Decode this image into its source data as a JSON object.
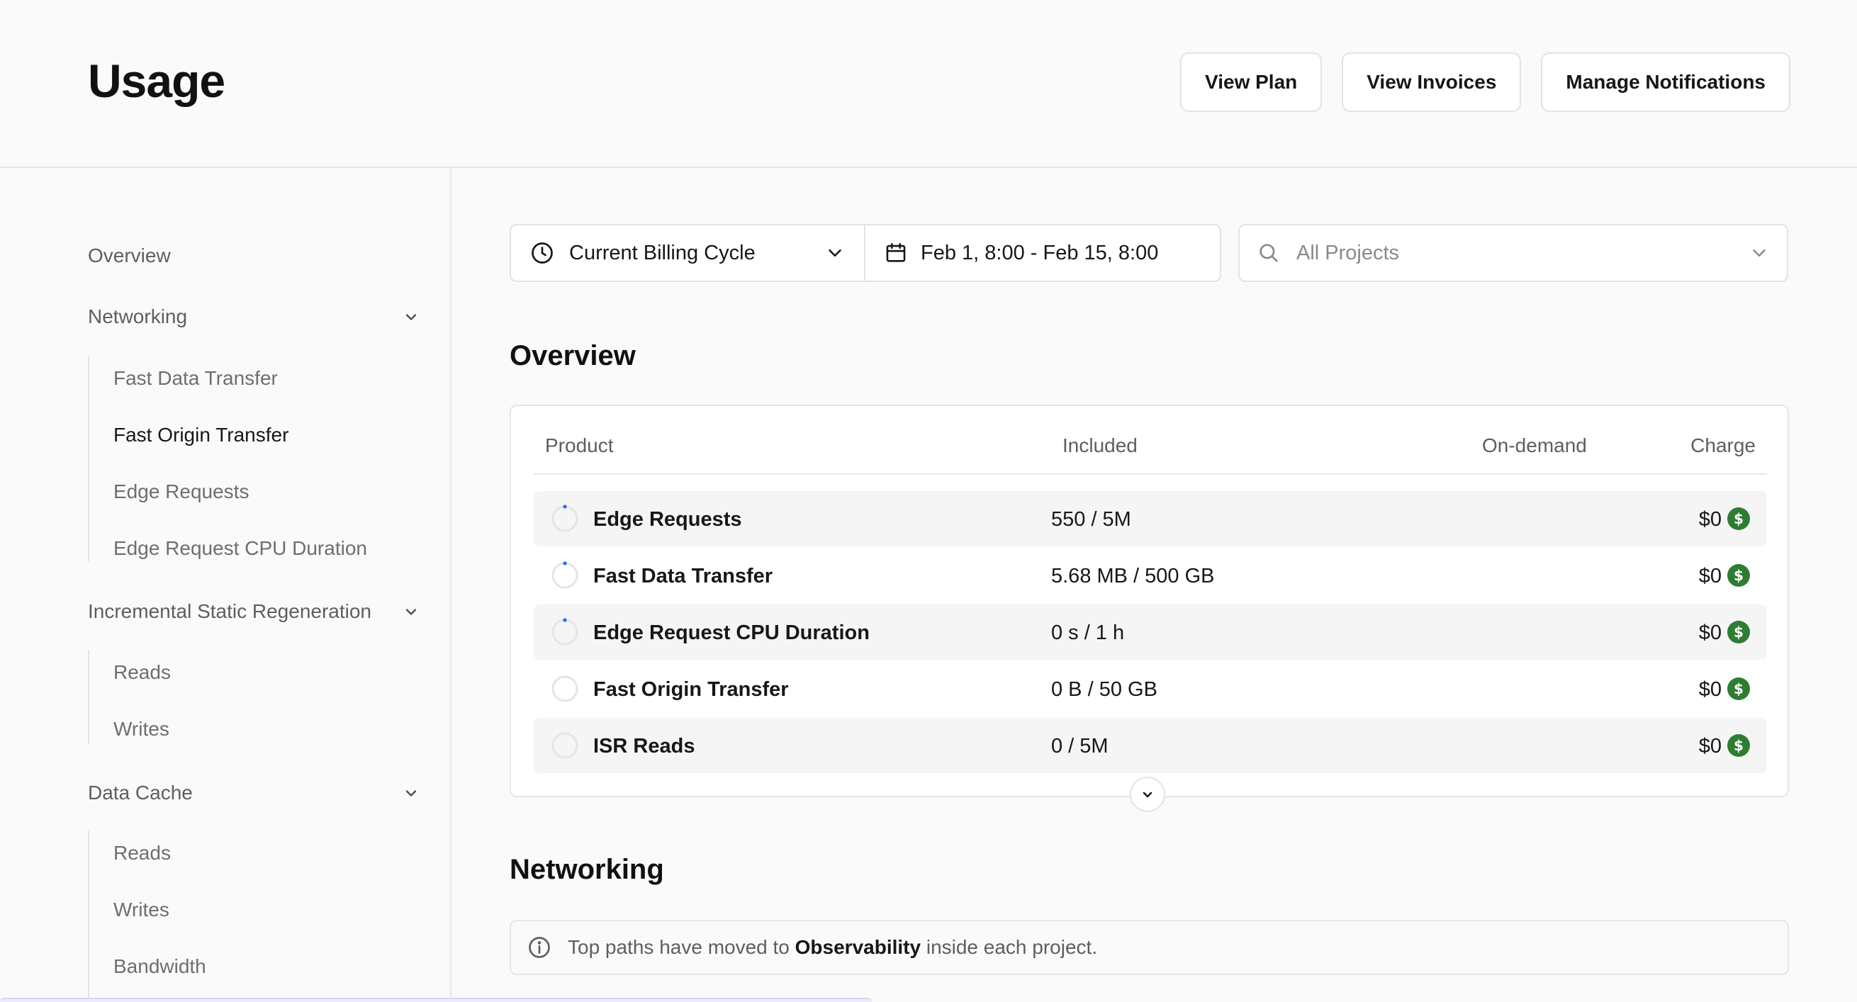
{
  "header": {
    "title": "Usage",
    "buttons": {
      "view_plan": "View Plan",
      "view_invoices": "View Invoices",
      "manage_notifications": "Manage Notifications"
    }
  },
  "sidebar": {
    "overview": "Overview",
    "networking": {
      "label": "Networking",
      "items": [
        "Fast Data Transfer",
        "Fast Origin Transfer",
        "Edge Requests",
        "Edge Request CPU Duration"
      ]
    },
    "isr": {
      "label": "Incremental Static Regeneration",
      "items": [
        "Reads",
        "Writes"
      ]
    },
    "data_cache": {
      "label": "Data Cache",
      "items": [
        "Reads",
        "Writes",
        "Bandwidth"
      ]
    },
    "active_item": "Fast Origin Transfer"
  },
  "filters": {
    "billing_cycle": "Current Billing Cycle",
    "date_range": "Feb 1, 8:00 - Feb 15, 8:00",
    "projects_placeholder": "All Projects"
  },
  "overview": {
    "title": "Overview",
    "columns": {
      "product": "Product",
      "included": "Included",
      "on_demand": "On-demand",
      "charge": "Charge"
    },
    "rows": [
      {
        "product": "Edge Requests",
        "included": "550 / 5M",
        "on_demand": "",
        "charge": "$0",
        "usage_fraction": 0.0001
      },
      {
        "product": "Fast Data Transfer",
        "included": "5.68 MB / 500 GB",
        "on_demand": "",
        "charge": "$0",
        "usage_fraction": 1e-05
      },
      {
        "product": "Edge Request CPU Duration",
        "included": "0 s / 1 h",
        "on_demand": "",
        "charge": "$0",
        "usage_fraction": 0
      },
      {
        "product": "Fast Origin Transfer",
        "included": "0 B / 50 GB",
        "on_demand": "",
        "charge": "$0",
        "usage_fraction": 0
      },
      {
        "product": "ISR Reads",
        "included": "0 / 5M",
        "on_demand": "",
        "charge": "$0",
        "usage_fraction": 0
      }
    ]
  },
  "networking": {
    "title": "Networking",
    "notice": {
      "prefix": "Top paths have moved to ",
      "link": "Observability",
      "suffix": " inside each project."
    }
  },
  "colors": {
    "accent_blue": "#1f6feb",
    "charge_green": "#2e7d32",
    "ring_track": "#e5e5e5"
  },
  "icons": {
    "clock": "clock-icon",
    "calendar": "calendar-icon",
    "search": "search-icon",
    "chevron": "chevron-down-icon",
    "info": "info-icon",
    "dollar": "dollar-icon"
  }
}
